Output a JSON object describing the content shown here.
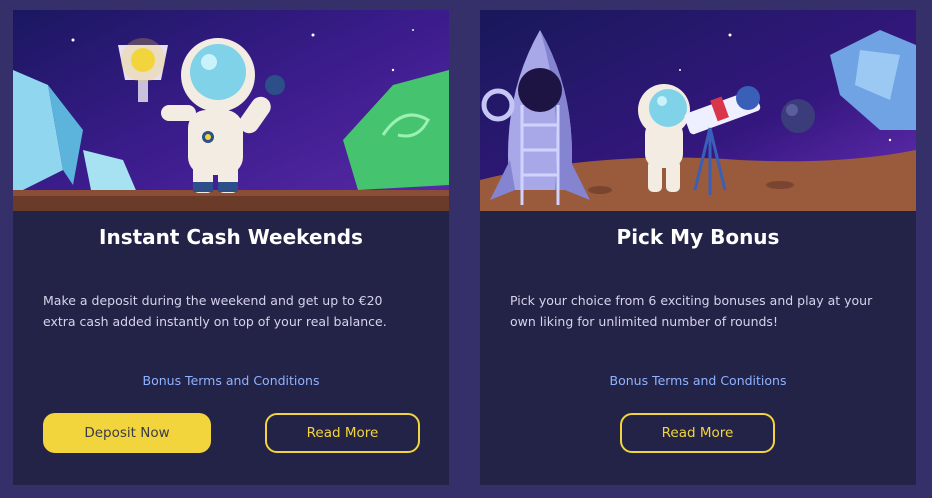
{
  "promotions": [
    {
      "title": "Instant Cash Weekends",
      "description": "Make a deposit during the weekend and get up to €20 extra cash added instantly on top of your real balance.",
      "terms_link": "Bonus Terms and Conditions",
      "primary_button": "Deposit Now",
      "secondary_button": "Read More",
      "image_icon": "astronaut-trophy-illustration"
    },
    {
      "title": "Pick My Bonus",
      "description": "Pick your choice from 6 exciting bonuses and play at your own liking for unlimited number of rounds!",
      "terms_link": "Bonus Terms and Conditions",
      "secondary_button": "Read More",
      "image_icon": "astronaut-rocket-telescope-illustration"
    }
  ],
  "colors": {
    "page_background": "#35306a",
    "card_background": "#232247",
    "accent_yellow": "#f2d53c",
    "link_blue": "#8fb3ff"
  }
}
